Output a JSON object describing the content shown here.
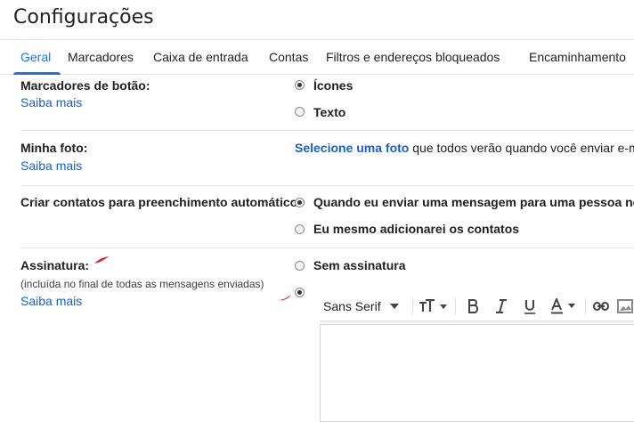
{
  "header": {
    "title": "Configurações"
  },
  "tabs": [
    {
      "label": "Geral",
      "active": true
    },
    {
      "label": "Marcadores"
    },
    {
      "label": "Caixa de entrada"
    },
    {
      "label": "Contas"
    },
    {
      "label": "Filtros e endereços bloqueados"
    },
    {
      "label": "Encaminhamento"
    }
  ],
  "settings": {
    "button_labels": {
      "label": "Marcadores de botão:",
      "learn_more": "Saiba mais",
      "options": [
        {
          "label": "Ícones",
          "selected": true
        },
        {
          "label": "Texto",
          "selected": false
        }
      ]
    },
    "my_photo": {
      "label": "Minha foto:",
      "learn_more": "Saiba mais",
      "select_link": "Selecione uma foto",
      "desc": " que todos verão quando você enviar e-m"
    },
    "auto_contacts": {
      "label": "Criar contatos para preenchimento automático:",
      "options": [
        {
          "label": "Quando eu enviar uma mensagem para uma pessoa nov",
          "selected": true
        },
        {
          "label": "Eu mesmo adicionarei os contatos",
          "selected": false
        }
      ]
    },
    "signature": {
      "label": "Assinatura:",
      "sub": "(incluída no final de todas as mensagens enviadas)",
      "learn_more": "Saiba mais",
      "options": [
        {
          "label": "Sem assinatura",
          "selected": false
        },
        {
          "label": "",
          "selected": true
        }
      ],
      "toolbar": {
        "font": "Sans Serif"
      }
    }
  },
  "colors": {
    "accent": "#1a73e8",
    "link": "#1a5fc9",
    "annotation": "#e8202a"
  }
}
